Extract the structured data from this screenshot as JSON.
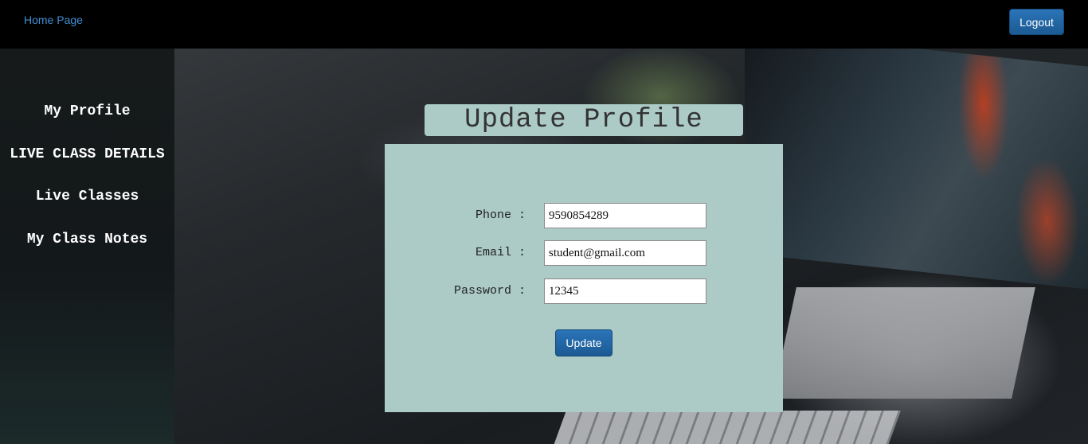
{
  "header": {
    "home_link": "Home Page",
    "logout_label": "Logout"
  },
  "sidebar": {
    "items": [
      {
        "label": "My Profile"
      },
      {
        "label": "LIVE CLASS DETAILS"
      },
      {
        "label": "Live Classes"
      },
      {
        "label": "My Class Notes"
      }
    ]
  },
  "form": {
    "title": "Update Profile",
    "fields": [
      {
        "label": "Phone :",
        "value": "9590854289"
      },
      {
        "label": "Email :",
        "value": "student@gmail.com"
      },
      {
        "label": "Password :",
        "value": "12345"
      }
    ],
    "submit_label": "Update"
  },
  "colors": {
    "panel_bg": "#accbc6",
    "button_blue": "#2a74b8",
    "link_blue": "#3f8fd6",
    "sidebar_bg": "#161a1b"
  }
}
